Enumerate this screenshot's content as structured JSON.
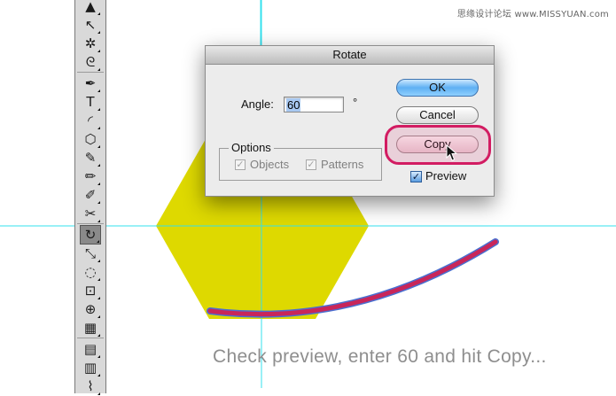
{
  "watermark": "思缘设计论坛  www.MISSYUAN.com",
  "dialog": {
    "title": "Rotate",
    "angle_label": "Angle:",
    "angle_value": "60",
    "degree_symbol": "°",
    "options_legend": "Options",
    "objects_label": "Objects",
    "patterns_label": "Patterns",
    "ok_label": "OK",
    "cancel_label": "Cancel",
    "copy_label": "Copy",
    "preview_label": "Preview",
    "objects_checked": true,
    "patterns_checked": true,
    "objects_enabled": false,
    "patterns_enabled": false,
    "preview_checked": true
  },
  "tools": [
    {
      "name": "selection-tool-icon",
      "glyph": "▲"
    },
    {
      "name": "direct-selection-tool-icon",
      "glyph": "↖"
    },
    {
      "name": "magic-wand-tool-icon",
      "glyph": "✲"
    },
    {
      "name": "lasso-tool-icon",
      "glyph": "ᘓ"
    },
    {
      "name": "pen-tool-icon",
      "glyph": "✒"
    },
    {
      "name": "type-tool-icon",
      "glyph": "T"
    },
    {
      "name": "line-segment-tool-icon",
      "glyph": "◜"
    },
    {
      "name": "polygon-tool-icon",
      "glyph": "⬡"
    },
    {
      "name": "paintbrush-tool-icon",
      "glyph": "✎"
    },
    {
      "name": "pencil-tool-icon",
      "glyph": "✏"
    },
    {
      "name": "eraser-tool-icon",
      "glyph": "✐"
    },
    {
      "name": "scissors-tool-icon",
      "glyph": "✂"
    },
    {
      "name": "rotate-tool-icon",
      "glyph": "↻"
    },
    {
      "name": "scale-tool-icon",
      "glyph": "⤡"
    },
    {
      "name": "warp-tool-icon",
      "glyph": "◌"
    },
    {
      "name": "free-transform-tool-icon",
      "glyph": "⊡"
    },
    {
      "name": "shape-builder-tool-icon",
      "glyph": "⊕"
    },
    {
      "name": "perspective-grid-tool-icon",
      "glyph": "▦"
    },
    {
      "name": "graph-tool-icon",
      "glyph": "▤"
    },
    {
      "name": "gradient-tool-icon",
      "glyph": "▥"
    },
    {
      "name": "eyedropper-tool-icon",
      "glyph": "⌇"
    }
  ],
  "selected_tool": "rotate-tool-icon",
  "colors": {
    "hexagon": "#ded900",
    "arc_stroke": "#c8265a",
    "arc_outline": "#4a6fd0",
    "guides": "#33e0ee",
    "copy_highlight": "#d21c62"
  },
  "caption": "Check preview, enter 60 and hit Copy..."
}
